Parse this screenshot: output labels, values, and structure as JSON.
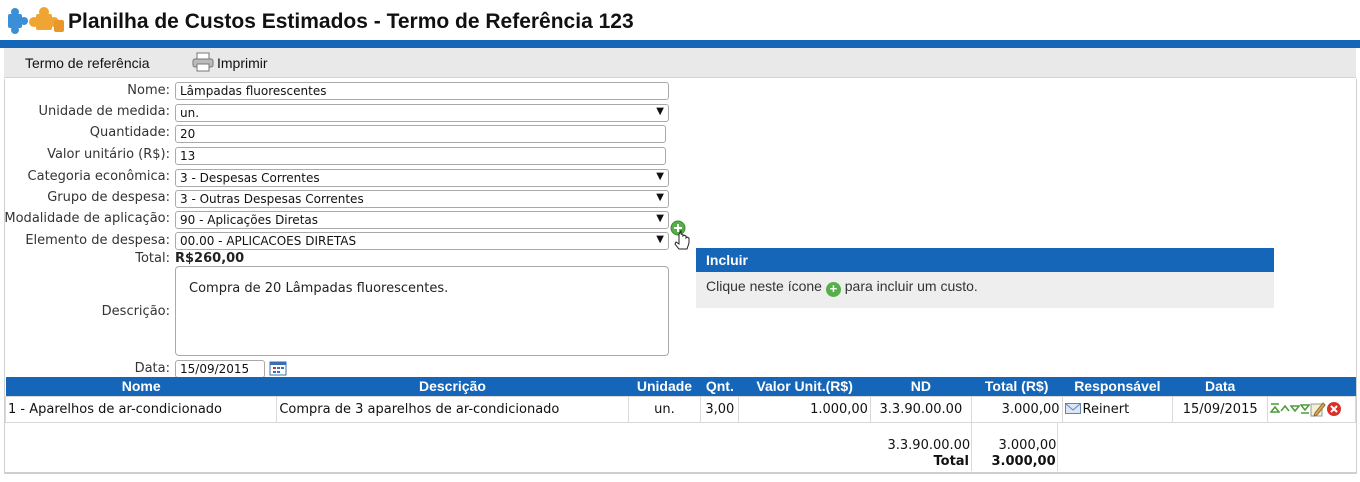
{
  "header": {
    "title": "Planilha de Custos Estimados - Termo de Referência 123"
  },
  "toolbar": {
    "ref_label": "Termo de referência",
    "print_label": "Imprimir"
  },
  "form": {
    "nome_label": "Nome:",
    "nome_value": "Lâmpadas fluorescentes",
    "unidade_label": "Unidade de medida:",
    "unidade_value": "un.",
    "quantidade_label": "Quantidade:",
    "quantidade_value": "20",
    "valor_label": "Valor unitário (R$):",
    "valor_value": "13",
    "categoria_label": "Categoria econômica:",
    "categoria_value": "3 - Despesas Correntes",
    "grupo_label": "Grupo de despesa:",
    "grupo_value": "3 - Outras Despesas Correntes",
    "modalidade_label": "Modalidade de aplicação:",
    "modalidade_value": "90 - Aplicações Diretas",
    "elemento_label": "Elemento de despesa:",
    "elemento_value": "00.00 - APLICACOES DIRETAS",
    "total_label": "Total:",
    "total_value": "R$260,00",
    "descricao_label": "Descrição:",
    "descricao_value": "Compra de 20 Lâmpadas fluorescentes.",
    "data_label": "Data:",
    "data_value": "15/09/2015"
  },
  "incluir": {
    "title": "Incluir",
    "text_before": "Clique neste ícone",
    "text_after": "para incluir um custo."
  },
  "table": {
    "headers": [
      "Nome",
      "Descrição",
      "Unidade",
      "Qnt.",
      "Valor Unit.(R$)",
      "ND",
      "Total (R$)",
      "Responsável",
      "Data"
    ],
    "rows": [
      {
        "nome": "1 - Aparelhos de ar-condicionado",
        "descricao": "Compra de 3 aparelhos de ar-condicionado",
        "unidade": "un.",
        "qnt": "3,00",
        "valor_unit": "1.000,00",
        "nd": "3.3.90.00.00",
        "total": "3.000,00",
        "responsavel": "Reinert",
        "data": "15/09/2015"
      }
    ],
    "summary_nd": "3.3.90.00.00",
    "summary_nd_value": "3.000,00",
    "total_label": "Total",
    "total_value": "3.000,00"
  },
  "colors": {
    "brand_blue": "#1565b8",
    "add_green": "#56b04a",
    "delete_red": "#d9302a"
  }
}
